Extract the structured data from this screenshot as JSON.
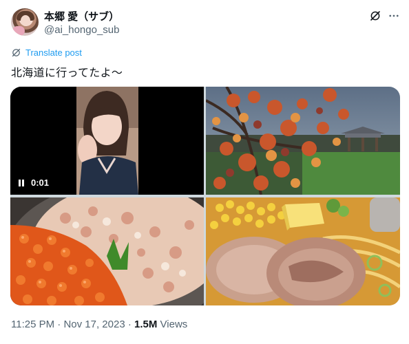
{
  "tweet": {
    "display_name": "本郷 愛（サブ）",
    "handle": "@ai_hongo_sub",
    "translate_label": "Translate post",
    "text": "北海道に行ってたよ〜",
    "video_time": "0:01",
    "meta": {
      "time": "11:25 PM",
      "separator1": " · ",
      "date": "Nov 17, 2023",
      "separator2": " · ",
      "views_count": "1.5M",
      "views_label": " Views"
    }
  },
  "icons": {
    "grok": "grok-icon",
    "more": "more-icon",
    "translate": "translate-icon",
    "pause": "pause-icon"
  },
  "colors": {
    "link": "#1d9bf0",
    "secondary_text": "#536471",
    "primary_text": "#0f1419"
  }
}
